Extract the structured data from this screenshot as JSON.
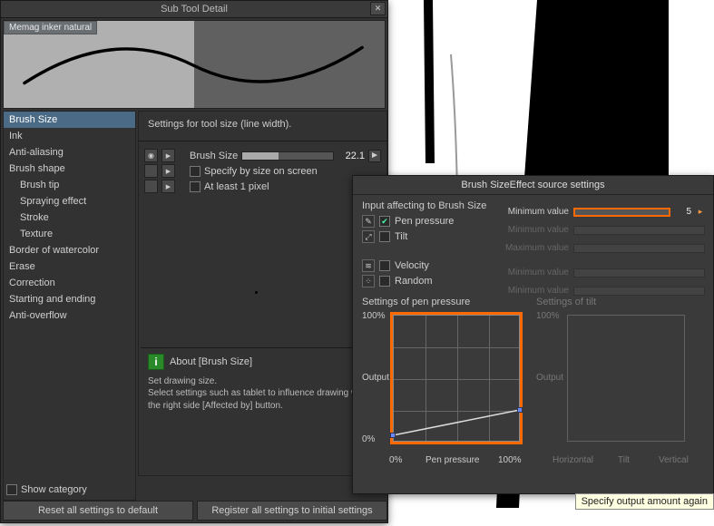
{
  "window_title": "Sub Tool Detail",
  "brush_name": "Memag inker natural",
  "sidebar": {
    "items": [
      {
        "label": "Brush Size",
        "selected": true,
        "indent": false
      },
      {
        "label": "Ink",
        "selected": false,
        "indent": false
      },
      {
        "label": "Anti-aliasing",
        "selected": false,
        "indent": false
      },
      {
        "label": "Brush shape",
        "selected": false,
        "indent": false
      },
      {
        "label": "Brush tip",
        "selected": false,
        "indent": true
      },
      {
        "label": "Spraying effect",
        "selected": false,
        "indent": true
      },
      {
        "label": "Stroke",
        "selected": false,
        "indent": true
      },
      {
        "label": "Texture",
        "selected": false,
        "indent": true
      },
      {
        "label": "Border of watercolor",
        "selected": false,
        "indent": false
      },
      {
        "label": "Erase",
        "selected": false,
        "indent": false
      },
      {
        "label": "Correction",
        "selected": false,
        "indent": false
      },
      {
        "label": "Starting and ending",
        "selected": false,
        "indent": false
      },
      {
        "label": "Anti-overflow",
        "selected": false,
        "indent": false
      }
    ],
    "show_category_label": "Show category"
  },
  "settings": {
    "description": "Settings for tool size (line width).",
    "brush_size_label": "Brush Size",
    "brush_size_value": "22.1",
    "specify_by_size_label": "Specify by size on screen",
    "at_least_1_pixel_label": "At least 1 pixel"
  },
  "about": {
    "title": "About [Brush Size]",
    "line1": "Set drawing size.",
    "line2": "Select settings such as tablet to influence drawing with the right side [Affected by] button."
  },
  "buttons": {
    "reset": "Reset all settings to default",
    "register": "Register all settings to initial settings"
  },
  "effect": {
    "title": "Brush SizeEffect source settings",
    "input_label": "Input affecting to Brush Size",
    "sources": [
      {
        "label": "Pen pressure",
        "checked": true
      },
      {
        "label": "Tilt",
        "checked": false
      },
      {
        "label": "Velocity",
        "checked": false
      },
      {
        "label": "Random",
        "checked": false
      }
    ],
    "sliders": [
      {
        "label": "Minimum value",
        "value": "5",
        "active": true
      },
      {
        "label": "Minimum value",
        "value": "",
        "active": false
      },
      {
        "label": "Maximum value",
        "value": "",
        "active": false
      },
      {
        "label": "Minimum value",
        "value": "",
        "active": false
      },
      {
        "label": "Minimum value",
        "value": "",
        "active": false
      }
    ],
    "pressure_curve": {
      "title": "Settings of pen pressure",
      "y100": "100%",
      "ylabel": "Output",
      "y0": "0%",
      "x0": "0%",
      "xlabel": "Pen pressure",
      "x100": "100%"
    },
    "tilt_curve": {
      "title": "Settings of tilt",
      "y100": "100%",
      "ylabel": "Output",
      "x_h": "Horizontal",
      "x_t": "Tilt",
      "x_v": "Vertical"
    }
  },
  "tooltip": "Specify output amount again",
  "chart_data": {
    "type": "line",
    "title": "Settings of pen pressure",
    "xlabel": "Pen pressure",
    "ylabel": "Output",
    "xlim": [
      0,
      100
    ],
    "ylim": [
      0,
      100
    ],
    "x": [
      0,
      100
    ],
    "values": [
      5,
      25
    ]
  }
}
